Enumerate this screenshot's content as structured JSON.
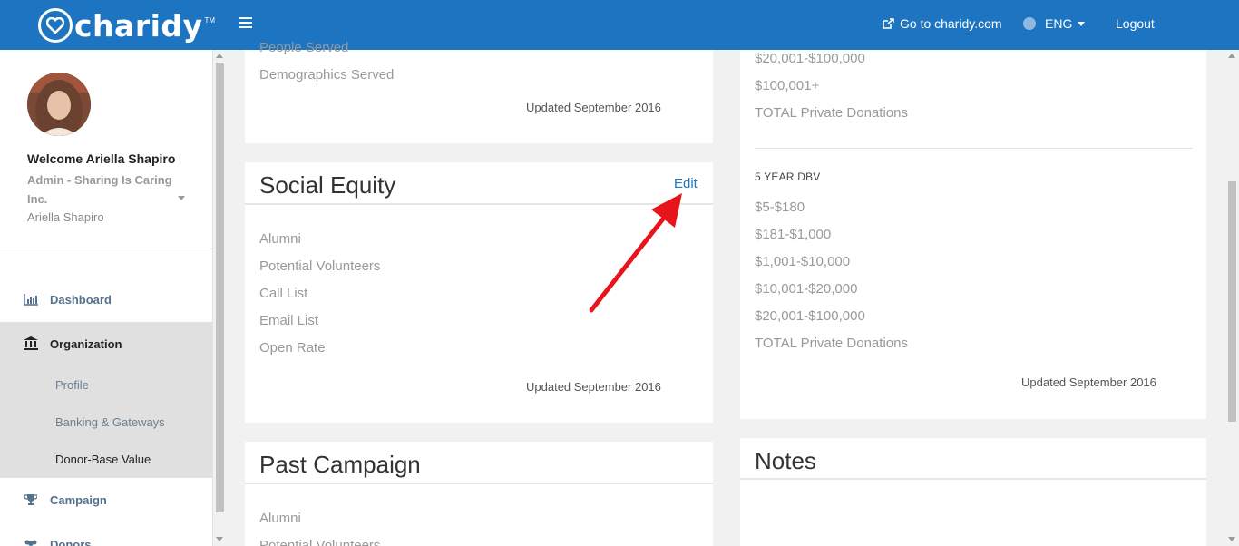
{
  "header": {
    "brand": "charidy",
    "goto_label": "Go to charidy.com",
    "lang_label": "ENG",
    "logout_label": "Logout"
  },
  "sidebar": {
    "welcome": "Welcome Ariella Shapiro",
    "admin": "Admin - Sharing Is Caring Inc.",
    "username": "Ariella Shapiro",
    "nav": {
      "dashboard": "Dashboard",
      "organization": "Organization",
      "profile": "Profile",
      "banking": "Banking & Gateways",
      "donor_base": "Donor-Base Value",
      "campaign": "Campaign",
      "donors": "Donors"
    }
  },
  "top_card": {
    "rows": [
      "People Served",
      "Demographics Served"
    ],
    "updated": "Updated September 2016"
  },
  "social_equity": {
    "title": "Social Equity",
    "edit_label": "Edit",
    "rows": [
      "Alumni",
      "Potential Volunteers",
      "Call List",
      "Email List",
      "Open Rate"
    ],
    "updated": "Updated September 2016"
  },
  "past_campaign": {
    "title": "Past Campaign",
    "rows": [
      "Alumni",
      "Potential Volunteers"
    ]
  },
  "right_card": {
    "top_rows": [
      "$20,001-$100,000",
      "$100,001+",
      "TOTAL Private Donations"
    ],
    "dbv_label": "5 YEAR DBV",
    "dbv_rows": [
      "$5-$180",
      "$181-$1,000",
      "$1,001-$10,000",
      "$10,001-$20,000",
      "$20,001-$100,000",
      "TOTAL Private Donations"
    ],
    "updated": "Updated September 2016"
  },
  "notes": {
    "title": "Notes"
  },
  "colors": {
    "brand_blue": "#1d74c0",
    "annotation_arrow": "#e8141b"
  }
}
